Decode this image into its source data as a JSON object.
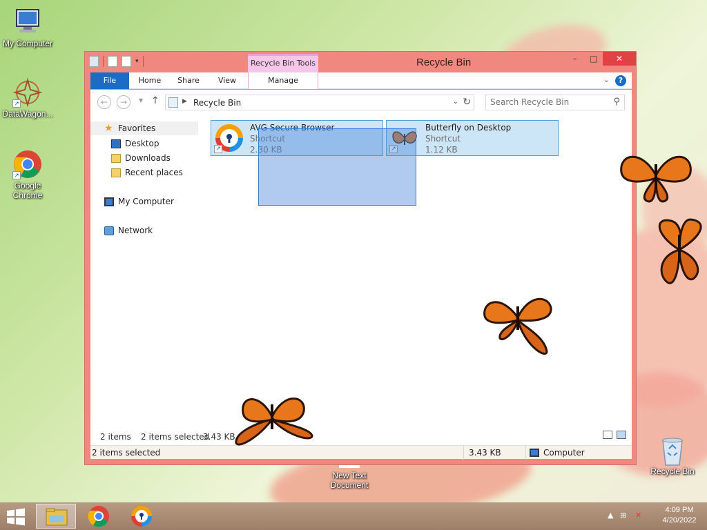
{
  "desktop": {
    "icons": [
      {
        "label": "My Computer",
        "icon": "monitor-icon"
      },
      {
        "label": "DataWagon...",
        "icon": "datawagon-icon"
      },
      {
        "label": "Google Chrome",
        "icon": "chrome-icon"
      },
      {
        "label": "New Text Document",
        "icon": "text-document-icon"
      },
      {
        "label": "Recycle Bin",
        "icon": "recycle-bin-icon"
      }
    ]
  },
  "window": {
    "title": "Recycle Bin",
    "context_tab": "Recycle Bin Tools",
    "controls": {
      "minimize": "–",
      "maximize": "□",
      "close": "✕"
    },
    "ribbon_tabs": [
      "File",
      "Home",
      "Share",
      "View",
      "Manage"
    ],
    "help": "?",
    "address": {
      "path": "Recycle Bin"
    },
    "search": {
      "placeholder": "Search Recycle Bin"
    },
    "nav_pane": {
      "favorites": "Favorites",
      "favorite_items": [
        "Desktop",
        "Downloads",
        "Recent places"
      ],
      "my_computer": "My Computer",
      "network": "Network"
    },
    "files": [
      {
        "name": "AVG Secure Browser",
        "type": "Shortcut",
        "size": "2.30 KB",
        "icon": "avg-browser-icon"
      },
      {
        "name": "Butterfly on Desktop",
        "type": "Shortcut",
        "size": "1.12 KB",
        "icon": "butterfly-icon"
      }
    ],
    "status": {
      "item_count": "2 items",
      "selected": "2 items selected",
      "selected_size": "3.43 KB"
    },
    "details_bar": {
      "selected": "2 items selected",
      "size": "3.43 KB",
      "location": "Computer"
    }
  },
  "taskbar": {
    "items": [
      "start-button",
      "file-explorer",
      "google-chrome",
      "avg-secure-browser"
    ],
    "clock": {
      "time": "4:09 PM",
      "date": "4/20/2022"
    }
  },
  "colors": {
    "window_frame": "#f08880",
    "file_tab": "#1c6bc5",
    "selection": "#cde6f7",
    "context_tab": "#f6c6e8"
  }
}
